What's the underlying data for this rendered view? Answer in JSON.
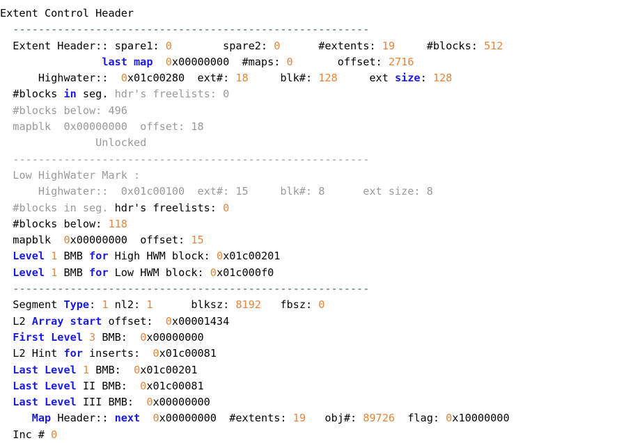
{
  "window": {
    "title": "Extent Control Header",
    "background": "#ffffff"
  },
  "colors": {
    "plain": "#000000",
    "keyword_blue": "#1a1ae6",
    "number_orange": "#e8843c",
    "dim_gray": "#9a9a9a",
    "rule_green": "#3d6b46",
    "rule_gray": "#9a9a9a"
  },
  "lines": [
    {
      "id": "title",
      "indent": 0,
      "tokens": [
        {
          "t": "Extent Control Header",
          "c": "p"
        }
      ]
    },
    {
      "id": "rule-1",
      "indent": 2,
      "tokens": [
        {
          "t": "--------------------------------------------------------",
          "c": "sep-green"
        }
      ]
    },
    {
      "id": "extent-header",
      "indent": 2,
      "tokens": [
        {
          "t": "Extent Header:: spare1: ",
          "c": "p"
        },
        {
          "t": "0",
          "c": "n"
        },
        {
          "t": "        spare2: ",
          "c": "p"
        },
        {
          "t": "0",
          "c": "n"
        },
        {
          "t": "      #extents: ",
          "c": "p"
        },
        {
          "t": "19",
          "c": "n"
        },
        {
          "t": "     #blocks: ",
          "c": "p"
        },
        {
          "t": "512",
          "c": "n"
        }
      ]
    },
    {
      "id": "last-map",
      "indent": 2,
      "tokens": [
        {
          "t": "              ",
          "c": "p"
        },
        {
          "t": "last map",
          "c": "k"
        },
        {
          "t": "  ",
          "c": "p"
        },
        {
          "t": "0",
          "c": "n"
        },
        {
          "t": "x00000000",
          "c": "p"
        },
        {
          "t": "  #maps: ",
          "c": "p"
        },
        {
          "t": "0",
          "c": "n"
        },
        {
          "t": "       offset: ",
          "c": "p"
        },
        {
          "t": "2716",
          "c": "n"
        }
      ]
    },
    {
      "id": "highwater-high",
      "indent": 2,
      "tokens": [
        {
          "t": "    Highwater::  ",
          "c": "p"
        },
        {
          "t": "0",
          "c": "n"
        },
        {
          "t": "x01c00280",
          "c": "p"
        },
        {
          "t": "  ext#: ",
          "c": "p"
        },
        {
          "t": "18",
          "c": "n"
        },
        {
          "t": "     blk#: ",
          "c": "p"
        },
        {
          "t": "128",
          "c": "n"
        },
        {
          "t": "     ext ",
          "c": "p"
        },
        {
          "t": "size",
          "c": "k"
        },
        {
          "t": ": ",
          "c": "p"
        },
        {
          "t": "128",
          "c": "n"
        }
      ]
    },
    {
      "id": "blocks-freelists-high",
      "indent": 2,
      "tokens": [
        {
          "t": "#blocks ",
          "c": "p"
        },
        {
          "t": "in",
          "c": "k"
        },
        {
          "t": " seg. ",
          "c": "p"
        },
        {
          "t": "hdr's freelists: 0",
          "c": "g"
        }
      ]
    },
    {
      "id": "blocks-below-high",
      "indent": 2,
      "tokens": [
        {
          "t": "#blocks below: 496",
          "c": "g"
        }
      ]
    },
    {
      "id": "mapblk-high",
      "indent": 2,
      "tokens": [
        {
          "t": "mapblk  0x00000000  offset: 18",
          "c": "g"
        }
      ]
    },
    {
      "id": "unlocked",
      "indent": 2,
      "tokens": [
        {
          "t": "             Unlocked",
          "c": "g"
        }
      ]
    },
    {
      "id": "rule-2",
      "indent": 2,
      "tokens": [
        {
          "t": "--------------------------------------------------------",
          "c": "sep-gray"
        }
      ]
    },
    {
      "id": "low-hwm-title",
      "indent": 2,
      "tokens": [
        {
          "t": "Low HighWater Mark :",
          "c": "g"
        }
      ]
    },
    {
      "id": "highwater-low",
      "indent": 2,
      "tokens": [
        {
          "t": "    Highwater::  0x01c00100  ext#: 15     blk#: 8      ext size: 8",
          "c": "g"
        }
      ]
    },
    {
      "id": "blocks-freelists-low",
      "indent": 2,
      "tokens": [
        {
          "t": "#blocks in seg. ",
          "c": "g"
        },
        {
          "t": "hdr's freelists: ",
          "c": "p"
        },
        {
          "t": "0",
          "c": "n"
        }
      ]
    },
    {
      "id": "blocks-below-low",
      "indent": 2,
      "tokens": [
        {
          "t": "#blocks below: ",
          "c": "p"
        },
        {
          "t": "118",
          "c": "n"
        }
      ]
    },
    {
      "id": "mapblk-low",
      "indent": 2,
      "tokens": [
        {
          "t": "mapblk  ",
          "c": "p"
        },
        {
          "t": "0",
          "c": "n"
        },
        {
          "t": "x00000000",
          "c": "p"
        },
        {
          "t": "  offset: ",
          "c": "p"
        },
        {
          "t": "15",
          "c": "n"
        }
      ]
    },
    {
      "id": "level-bmb-high",
      "indent": 2,
      "tokens": [
        {
          "t": "Level",
          "c": "k"
        },
        {
          "t": " ",
          "c": "p"
        },
        {
          "t": "1",
          "c": "n"
        },
        {
          "t": " BMB ",
          "c": "p"
        },
        {
          "t": "for",
          "c": "k"
        },
        {
          "t": " High HWM block: ",
          "c": "p"
        },
        {
          "t": "0",
          "c": "n"
        },
        {
          "t": "x01c00201",
          "c": "p"
        }
      ]
    },
    {
      "id": "level-bmb-low",
      "indent": 2,
      "tokens": [
        {
          "t": "Level",
          "c": "k"
        },
        {
          "t": " ",
          "c": "p"
        },
        {
          "t": "1",
          "c": "n"
        },
        {
          "t": " BMB ",
          "c": "p"
        },
        {
          "t": "for",
          "c": "k"
        },
        {
          "t": " Low HWM block: ",
          "c": "p"
        },
        {
          "t": "0",
          "c": "n"
        },
        {
          "t": "x01c000f0",
          "c": "p"
        }
      ]
    },
    {
      "id": "rule-3",
      "indent": 2,
      "tokens": [
        {
          "t": "--------------------------------------------------------",
          "c": "sep-green"
        }
      ]
    },
    {
      "id": "segment-type",
      "indent": 2,
      "tokens": [
        {
          "t": "Segment ",
          "c": "p"
        },
        {
          "t": "Type",
          "c": "k"
        },
        {
          "t": ": ",
          "c": "p"
        },
        {
          "t": "1",
          "c": "n"
        },
        {
          "t": " nl2: ",
          "c": "p"
        },
        {
          "t": "1",
          "c": "n"
        },
        {
          "t": "      blksz: ",
          "c": "p"
        },
        {
          "t": "8192",
          "c": "n"
        },
        {
          "t": "   fbsz: ",
          "c": "p"
        },
        {
          "t": "0",
          "c": "n"
        }
      ]
    },
    {
      "id": "l2-array-start",
      "indent": 2,
      "tokens": [
        {
          "t": "L2 ",
          "c": "p"
        },
        {
          "t": "Array start",
          "c": "k"
        },
        {
          "t": " offset:  ",
          "c": "p"
        },
        {
          "t": "0",
          "c": "n"
        },
        {
          "t": "x00001434",
          "c": "p"
        }
      ]
    },
    {
      "id": "first-level-bmb",
      "indent": 2,
      "tokens": [
        {
          "t": "First Level",
          "c": "k"
        },
        {
          "t": " ",
          "c": "p"
        },
        {
          "t": "3",
          "c": "n"
        },
        {
          "t": " BMB:  ",
          "c": "p"
        },
        {
          "t": "0",
          "c": "n"
        },
        {
          "t": "x00000000",
          "c": "p"
        }
      ]
    },
    {
      "id": "l2-hint-inserts",
      "indent": 2,
      "tokens": [
        {
          "t": "L2 Hint ",
          "c": "p"
        },
        {
          "t": "for",
          "c": "k"
        },
        {
          "t": " inserts:  ",
          "c": "p"
        },
        {
          "t": "0",
          "c": "n"
        },
        {
          "t": "x01c00081",
          "c": "p"
        }
      ]
    },
    {
      "id": "last-level-1-bmb",
      "indent": 2,
      "tokens": [
        {
          "t": "Last Level",
          "c": "k"
        },
        {
          "t": " ",
          "c": "p"
        },
        {
          "t": "1",
          "c": "n"
        },
        {
          "t": " BMB:  ",
          "c": "p"
        },
        {
          "t": "0",
          "c": "n"
        },
        {
          "t": "x01c00201",
          "c": "p"
        }
      ]
    },
    {
      "id": "last-level-2-bmb",
      "indent": 2,
      "tokens": [
        {
          "t": "Last Level",
          "c": "k"
        },
        {
          "t": " II BMB:  ",
          "c": "p"
        },
        {
          "t": "0",
          "c": "n"
        },
        {
          "t": "x01c00081",
          "c": "p"
        }
      ]
    },
    {
      "id": "last-level-3-bmb",
      "indent": 2,
      "tokens": [
        {
          "t": "Last Level",
          "c": "k"
        },
        {
          "t": " III BMB:  ",
          "c": "p"
        },
        {
          "t": "0",
          "c": "n"
        },
        {
          "t": "x00000000",
          "c": "p"
        }
      ]
    },
    {
      "id": "map-header",
      "indent": 2,
      "tokens": [
        {
          "t": "   ",
          "c": "p"
        },
        {
          "t": "Map",
          "c": "k"
        },
        {
          "t": " Header:: ",
          "c": "p"
        },
        {
          "t": "next",
          "c": "k"
        },
        {
          "t": "  ",
          "c": "p"
        },
        {
          "t": "0",
          "c": "n"
        },
        {
          "t": "x00000000",
          "c": "p"
        },
        {
          "t": "  #extents: ",
          "c": "p"
        },
        {
          "t": "19",
          "c": "n"
        },
        {
          "t": "   obj#: ",
          "c": "p"
        },
        {
          "t": "89726",
          "c": "n"
        },
        {
          "t": "  flag: ",
          "c": "p"
        },
        {
          "t": "0",
          "c": "n"
        },
        {
          "t": "x10000000",
          "c": "p"
        }
      ]
    },
    {
      "id": "inc-num",
      "indent": 2,
      "tokens": [
        {
          "t": "Inc # ",
          "c": "p"
        },
        {
          "t": "0",
          "c": "n"
        }
      ]
    }
  ]
}
